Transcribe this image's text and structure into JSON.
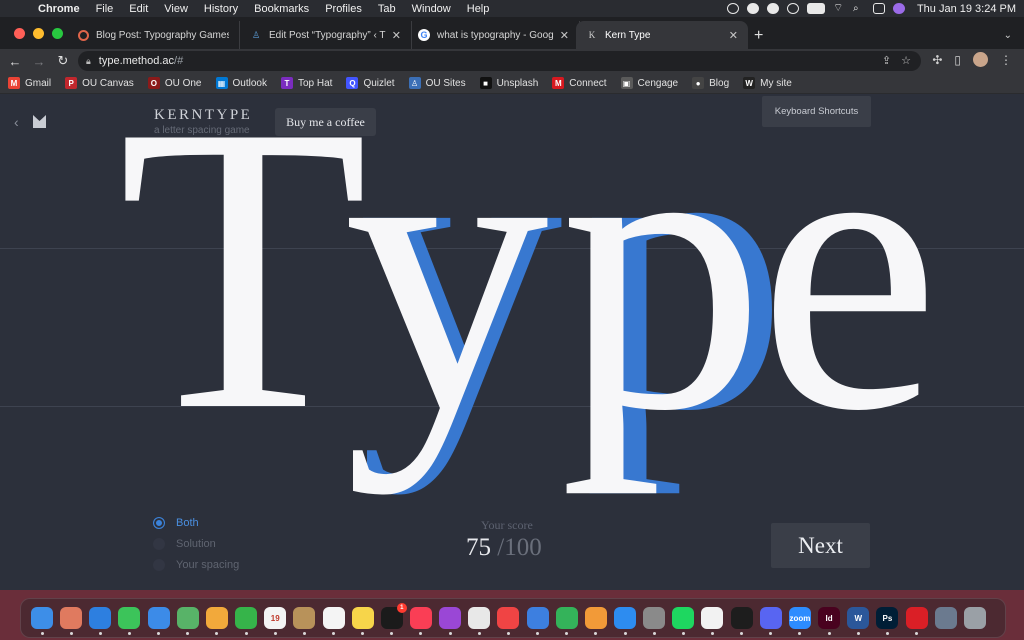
{
  "menubar": {
    "app_name": "Chrome",
    "items": [
      "File",
      "Edit",
      "View",
      "History",
      "Bookmarks",
      "Profiles",
      "Tab",
      "Window",
      "Help"
    ],
    "clock": "Thu Jan 19  3:24 PM"
  },
  "tabs": [
    {
      "title": "Blog Post: Typography Games",
      "icon": "blog-favicon"
    },
    {
      "title": "Edit Post “Typography” ‹ The M",
      "icon": "wordpress-favicon"
    },
    {
      "title": "what is typography - Google Se",
      "icon": "google-favicon"
    },
    {
      "title": "Kern Type",
      "icon": "kern-favicon",
      "active": true
    }
  ],
  "omnibox": {
    "host": "type.method.ac",
    "path": "/#"
  },
  "bookmarks": [
    {
      "label": "Gmail",
      "color": "#ea4335",
      "glyph": "M"
    },
    {
      "label": "OU Canvas",
      "color": "#c1272d",
      "glyph": "P"
    },
    {
      "label": "OU One",
      "color": "#8b1a1a",
      "glyph": "O"
    },
    {
      "label": "Outlook",
      "color": "#0078d4",
      "glyph": "▦"
    },
    {
      "label": "Top Hat",
      "color": "#7b2cbf",
      "glyph": "T"
    },
    {
      "label": "Quizlet",
      "color": "#4255ff",
      "glyph": "Q"
    },
    {
      "label": "OU Sites",
      "color": "#3b6fb6",
      "glyph": "♙"
    },
    {
      "label": "Unsplash",
      "color": "#111111",
      "glyph": "■"
    },
    {
      "label": "Connect",
      "color": "#d71920",
      "glyph": "M"
    },
    {
      "label": "Cengage",
      "color": "#5a5a5a",
      "glyph": "▣"
    },
    {
      "label": "Blog",
      "color": "#444444",
      "glyph": "●"
    },
    {
      "label": "My site",
      "color": "#222222",
      "glyph": "W"
    }
  ],
  "app": {
    "title": "KERNTYPE",
    "subtitle": "a letter spacing game",
    "coffee_button": "Buy me a coffee",
    "shortcuts_button": "Keyboard Shortcuts",
    "word": "Type",
    "letters": [
      "T",
      "y",
      "p",
      "e"
    ],
    "solution_color": "#3878d0",
    "user_color": "#f7f7f9",
    "view_options": [
      {
        "label": "Both",
        "selected": true
      },
      {
        "label": "Solution",
        "selected": false
      },
      {
        "label": "Your spacing",
        "selected": false
      }
    ],
    "score_label": "Your score",
    "score": "75",
    "score_separator": "/",
    "score_max": "100",
    "next_button": "Next"
  },
  "dock": {
    "apps": [
      {
        "name": "Finder",
        "color": "#3d8ee8"
      },
      {
        "name": "Launchpad",
        "color": "#e07a5f"
      },
      {
        "name": "Safari",
        "color": "#2d7fe0"
      },
      {
        "name": "Messages",
        "color": "#3cc45a"
      },
      {
        "name": "Mail",
        "color": "#3c8be8"
      },
      {
        "name": "Maps",
        "color": "#58b368"
      },
      {
        "name": "Photos",
        "color": "#f2a93b"
      },
      {
        "name": "FaceTime",
        "color": "#36b44a"
      },
      {
        "name": "Calendar",
        "color": "#f4f4f4",
        "label": "19"
      },
      {
        "name": "Contacts",
        "color": "#b8925a"
      },
      {
        "name": "Reminders",
        "color": "#f4f4f4"
      },
      {
        "name": "Notes",
        "color": "#f7d54a"
      },
      {
        "name": "TV",
        "color": "#1b1b1b",
        "badge": "1"
      },
      {
        "name": "Music",
        "color": "#fa3e55"
      },
      {
        "name": "Podcasts",
        "color": "#9a47d6"
      },
      {
        "name": "Chrome",
        "color": "#e8e8e8"
      },
      {
        "name": "News",
        "color": "#f04444"
      },
      {
        "name": "Keynote",
        "color": "#3d7fe0"
      },
      {
        "name": "Numbers",
        "color": "#34b35a"
      },
      {
        "name": "Pages",
        "color": "#f29a38"
      },
      {
        "name": "App Store",
        "color": "#2d8cf0"
      },
      {
        "name": "System Preferences",
        "color": "#8a8a8a"
      },
      {
        "name": "Spotify",
        "color": "#1ed760"
      },
      {
        "name": "Play",
        "color": "#f2f2f2"
      },
      {
        "name": "Activity Monitor",
        "color": "#1d1d1d"
      },
      {
        "name": "Discord",
        "color": "#5865f2"
      },
      {
        "name": "Zoom",
        "color": "#2d8cff",
        "label": "zoom"
      },
      {
        "name": "InDesign",
        "color": "#49021f",
        "label": "Id"
      },
      {
        "name": "Word",
        "color": "#2b579a",
        "label": "W"
      },
      {
        "name": "Photoshop",
        "color": "#001e36",
        "label": "Ps"
      },
      {
        "name": "Creative Cloud",
        "color": "#da1f26"
      },
      {
        "name": "Downloads",
        "color": "#6b7a8f"
      },
      {
        "name": "Trash",
        "color": "#9aa0a6"
      }
    ]
  }
}
